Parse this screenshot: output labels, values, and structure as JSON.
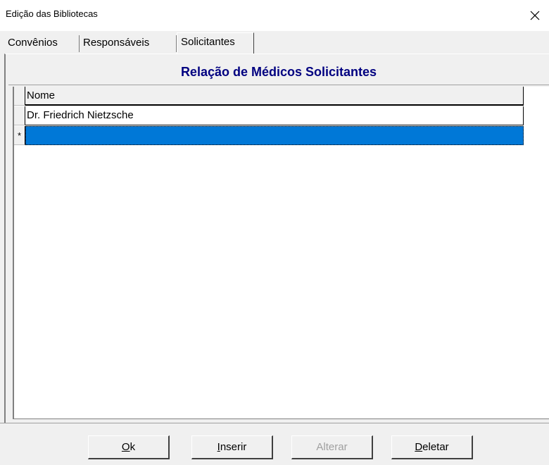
{
  "window": {
    "title": "Edição das Bibliotecas"
  },
  "tabs": [
    {
      "label": "Convênios"
    },
    {
      "label": "Responsáveis"
    },
    {
      "label": "Solicitantes"
    }
  ],
  "panel": {
    "heading": "Relação de Médicos Solicitantes"
  },
  "grid": {
    "column_header": "Nome",
    "rows": [
      {
        "nome": "Dr. Friedrich Nietzsche"
      }
    ],
    "new_row_marker": "*"
  },
  "buttons": {
    "ok": {
      "accel": "O",
      "rest": "k"
    },
    "inserir": {
      "accel": "I",
      "rest": "nserir"
    },
    "alterar": {
      "label": "Alterar"
    },
    "deletar": {
      "accel": "D",
      "rest": "eletar"
    }
  },
  "colors": {
    "heading": "#000080",
    "selection": "#0078d7"
  },
  "icons": {
    "close": "close-icon"
  }
}
